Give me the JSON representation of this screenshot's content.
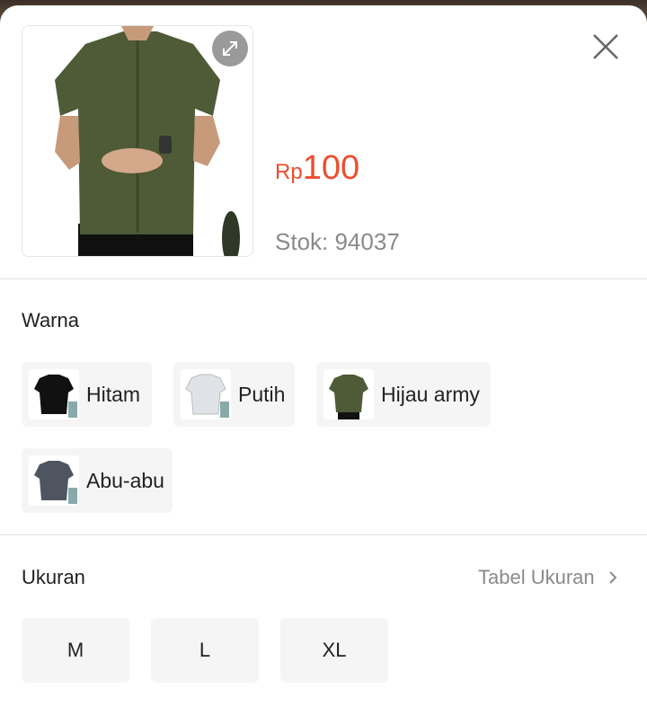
{
  "product": {
    "price_currency": "Rp",
    "price_amount": "100",
    "stock_text": "Stok: 94037"
  },
  "colors": {
    "label": "Warna",
    "options": [
      {
        "name": "Hitam",
        "swatch": "#111111"
      },
      {
        "name": "Putih",
        "swatch": "#dfe3e8"
      },
      {
        "name": "Hijau army",
        "swatch": "#4e5b36"
      },
      {
        "name": "Abu-abu",
        "swatch": "#4f5560"
      }
    ]
  },
  "sizes": {
    "label": "Ukuran",
    "chart_link": "Tabel Ukuran",
    "options": [
      "M",
      "L",
      "XL"
    ]
  },
  "theme": {
    "accent": "#ee4d2d",
    "muted": "#8a8a8a",
    "chip_bg": "#f5f5f5"
  }
}
